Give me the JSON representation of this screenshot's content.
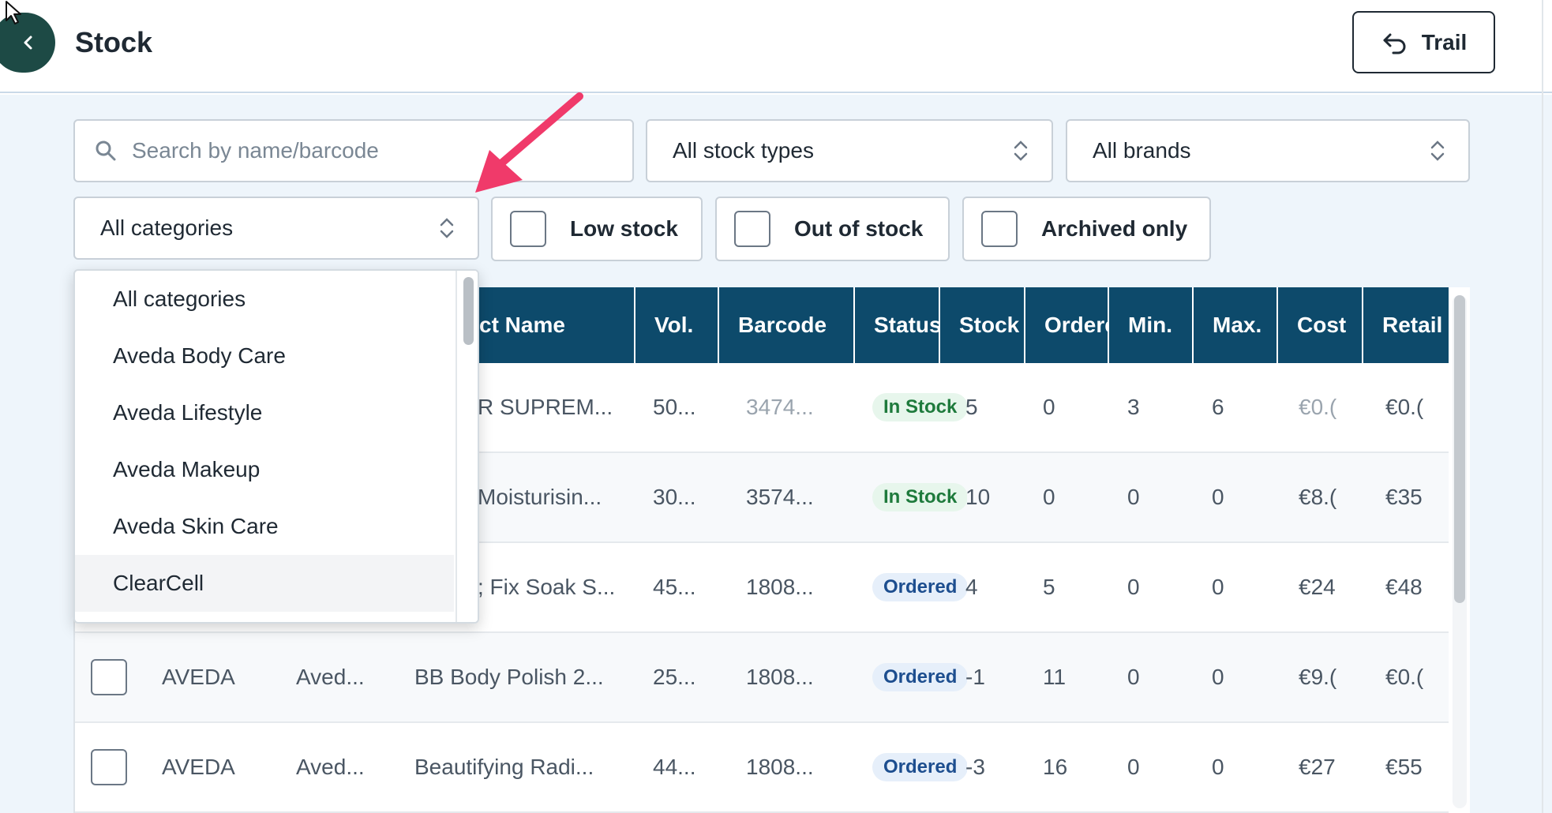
{
  "header": {
    "title": "Stock",
    "trail_label": "Trail"
  },
  "filters": {
    "search_placeholder": "Search by name/barcode",
    "stock_types": "All stock types",
    "brands": "All brands",
    "categories": "All categories",
    "low_stock": "Low stock",
    "out_of_stock": "Out of stock",
    "archived_only": "Archived only"
  },
  "table": {
    "columns": [
      "ct Name",
      "Vol.",
      "Barcode",
      "Status",
      "Stock",
      "Ordere",
      "Min.",
      "Max.",
      "Cost",
      "Retail"
    ],
    "rows": [
      {
        "brand": "",
        "category": "",
        "name": "R SUPREM...",
        "vol": "50...",
        "barcode": "3474...",
        "status": "In Stock",
        "stock": "5",
        "ordered": "0",
        "min": "3",
        "max": "6",
        "cost": "€0.(",
        "retail": "€0.("
      },
      {
        "brand": "",
        "category": "",
        "name": "Moisturisin...",
        "vol": "30...",
        "barcode": "3574...",
        "status": "In Stock",
        "stock": "10",
        "ordered": "0",
        "min": "0",
        "max": "0",
        "cost": "€8.(",
        "retail": "€35"
      },
      {
        "brand": "",
        "category": "",
        "name": "; Fix Soak S...",
        "vol": "45...",
        "barcode": "1808...",
        "status": "Ordered",
        "stock": "4",
        "ordered": "5",
        "min": "0",
        "max": "0",
        "cost": "€24",
        "retail": "€48"
      },
      {
        "brand": "AVEDA",
        "category": "Aved...",
        "name": "BB Body Polish 2...",
        "vol": "25...",
        "barcode": "1808...",
        "status": "Ordered",
        "stock": "-1",
        "ordered": "11",
        "min": "0",
        "max": "0",
        "cost": "€9.(",
        "retail": "€0.("
      },
      {
        "brand": "AVEDA",
        "category": "Aved...",
        "name": "Beautifying Radi...",
        "vol": "44...",
        "barcode": "1808...",
        "status": "Ordered",
        "stock": "-3",
        "ordered": "16",
        "min": "0",
        "max": "0",
        "cost": "€27",
        "retail": "€55"
      }
    ]
  },
  "category_dropdown": {
    "options": [
      "All categories",
      "Aveda Body Care",
      "Aveda Lifestyle",
      "Aveda Makeup",
      "Aveda Skin Care",
      "ClearCell"
    ],
    "highlighted": "ClearCell"
  },
  "colors": {
    "header_bg": "#0d4a6b",
    "back_button": "#1d4a45",
    "annotation_arrow": "#f03a6a",
    "in_stock_badge": "#1e7a3c",
    "ordered_badge": "#1d4e8f"
  },
  "icons": [
    "chevron-left-icon",
    "undo-arrow-icon",
    "search-icon",
    "updown-chevron-icon",
    "cursor-icon",
    "annotation-arrow"
  ]
}
